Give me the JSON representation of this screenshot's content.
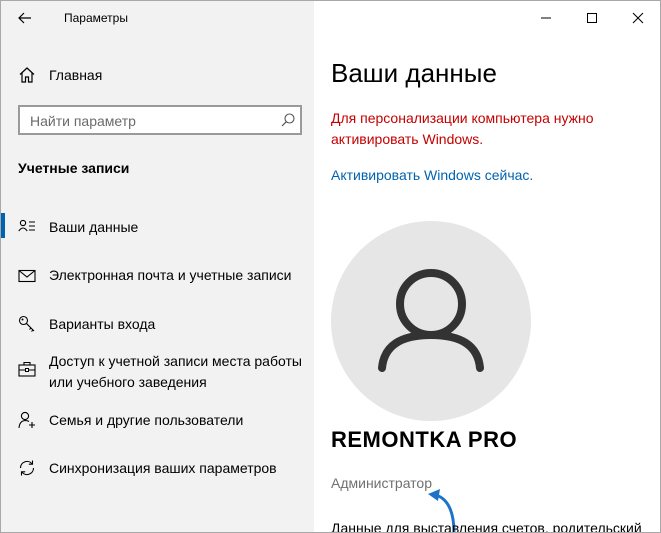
{
  "window": {
    "title": "Параметры"
  },
  "sidebar": {
    "home_label": "Главная",
    "search": {
      "placeholder": "Найти параметр",
      "value": ""
    },
    "section_title": "Учетные записи",
    "items": [
      {
        "label": "Ваши данные",
        "icon": "user-info-icon",
        "active": true
      },
      {
        "label": "Электронная почта и учетные записи",
        "icon": "mail-icon",
        "active": false
      },
      {
        "label": "Варианты входа",
        "icon": "key-icon",
        "active": false
      },
      {
        "label": "Доступ к учетной записи места работы или учебного заведения",
        "icon": "briefcase-icon",
        "active": false
      },
      {
        "label": "Семья и другие пользователи",
        "icon": "person-add-icon",
        "active": false
      },
      {
        "label": "Синхронизация ваших параметров",
        "icon": "sync-icon",
        "active": false
      }
    ]
  },
  "main": {
    "title": "Ваши данные",
    "warning": "Для персонализации компьютера нужно активировать Windows.",
    "activate_link": "Активировать Windows сейчас.",
    "user_name": "REMONTKA PRO",
    "user_role": "Администратор",
    "bottom_text": "Данные для выставления счетов, родительский"
  },
  "colors": {
    "accent": "#0063b1",
    "warning": "#c50000",
    "sidebar_bg": "#f2f2f2",
    "avatar_bg": "#e6e6e6"
  }
}
